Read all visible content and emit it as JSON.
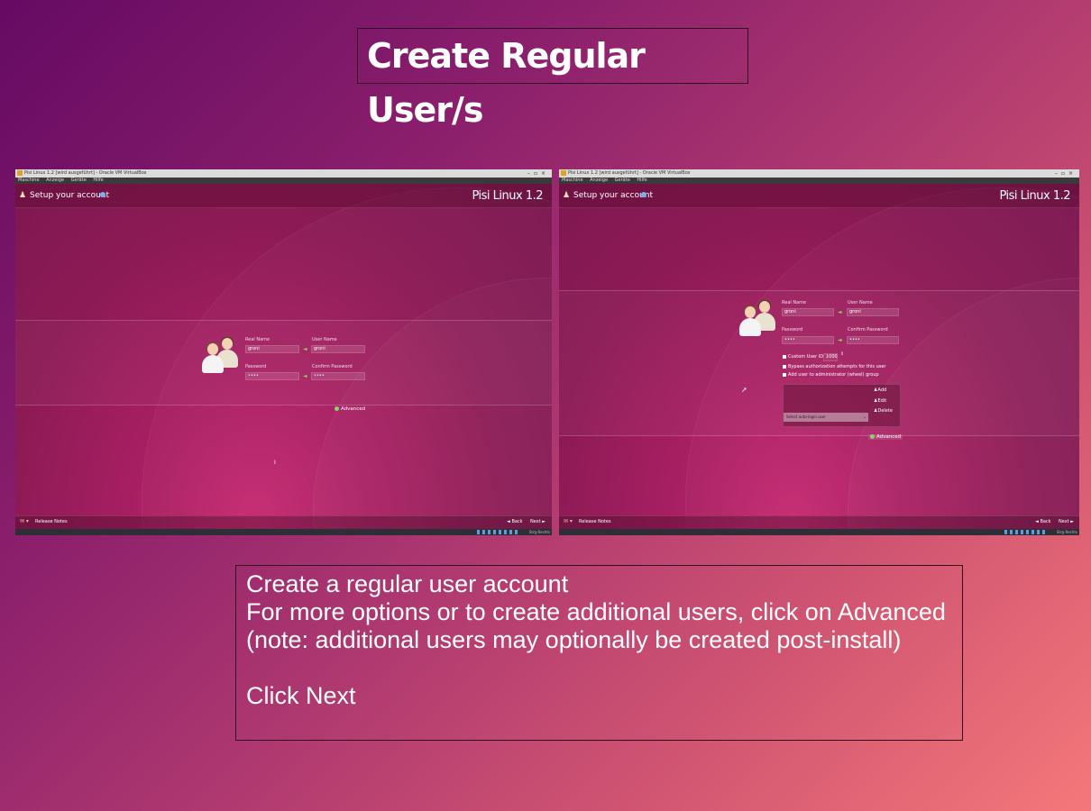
{
  "slide": {
    "title": "Create Regular User/s",
    "caption_lines": [
      "Create a regular user account",
      "For more options or to create additional users, click on Advanced",
      "(note: additional users may optionally be created post-install)",
      "",
      "Click Next"
    ]
  },
  "vm_window": {
    "title": "Pisi Linux 1.2 [wird ausgeführt] - Oracle VM VirtualBox",
    "menu": [
      "Maschine",
      "Anzeige",
      "Geräte",
      "Hilfe"
    ],
    "tray_text": "Strg-Rechts"
  },
  "installer": {
    "page_title": "Setup your account",
    "brand": "Pisi Linux 1.2",
    "labels": {
      "real_name": "Real Name",
      "user_name": "User Name",
      "password": "Password",
      "confirm_password": "Confirm Password"
    },
    "values": {
      "real_name": "groni",
      "user_name": "groni",
      "password": "••••",
      "confirm_password": "••••"
    },
    "advanced_label": "Advanced",
    "release_notes": "Release Notes",
    "back_label": "Back",
    "next_label": "Next",
    "advanced_options": {
      "custom_uid_label": "Custom User ID",
      "custom_uid_value": "1000",
      "bypass_auth_label": "Bypass authorization attempts for this user",
      "add_admin_label": "Add user to administrator (wheel) group",
      "add_label": "Add",
      "edit_label": "Edit",
      "delete_label": "Delete",
      "autologin_placeholder": "Select auto-login user"
    }
  },
  "colors": {
    "accent_green": "#7fdc5a",
    "header_text": "#ffffff"
  }
}
